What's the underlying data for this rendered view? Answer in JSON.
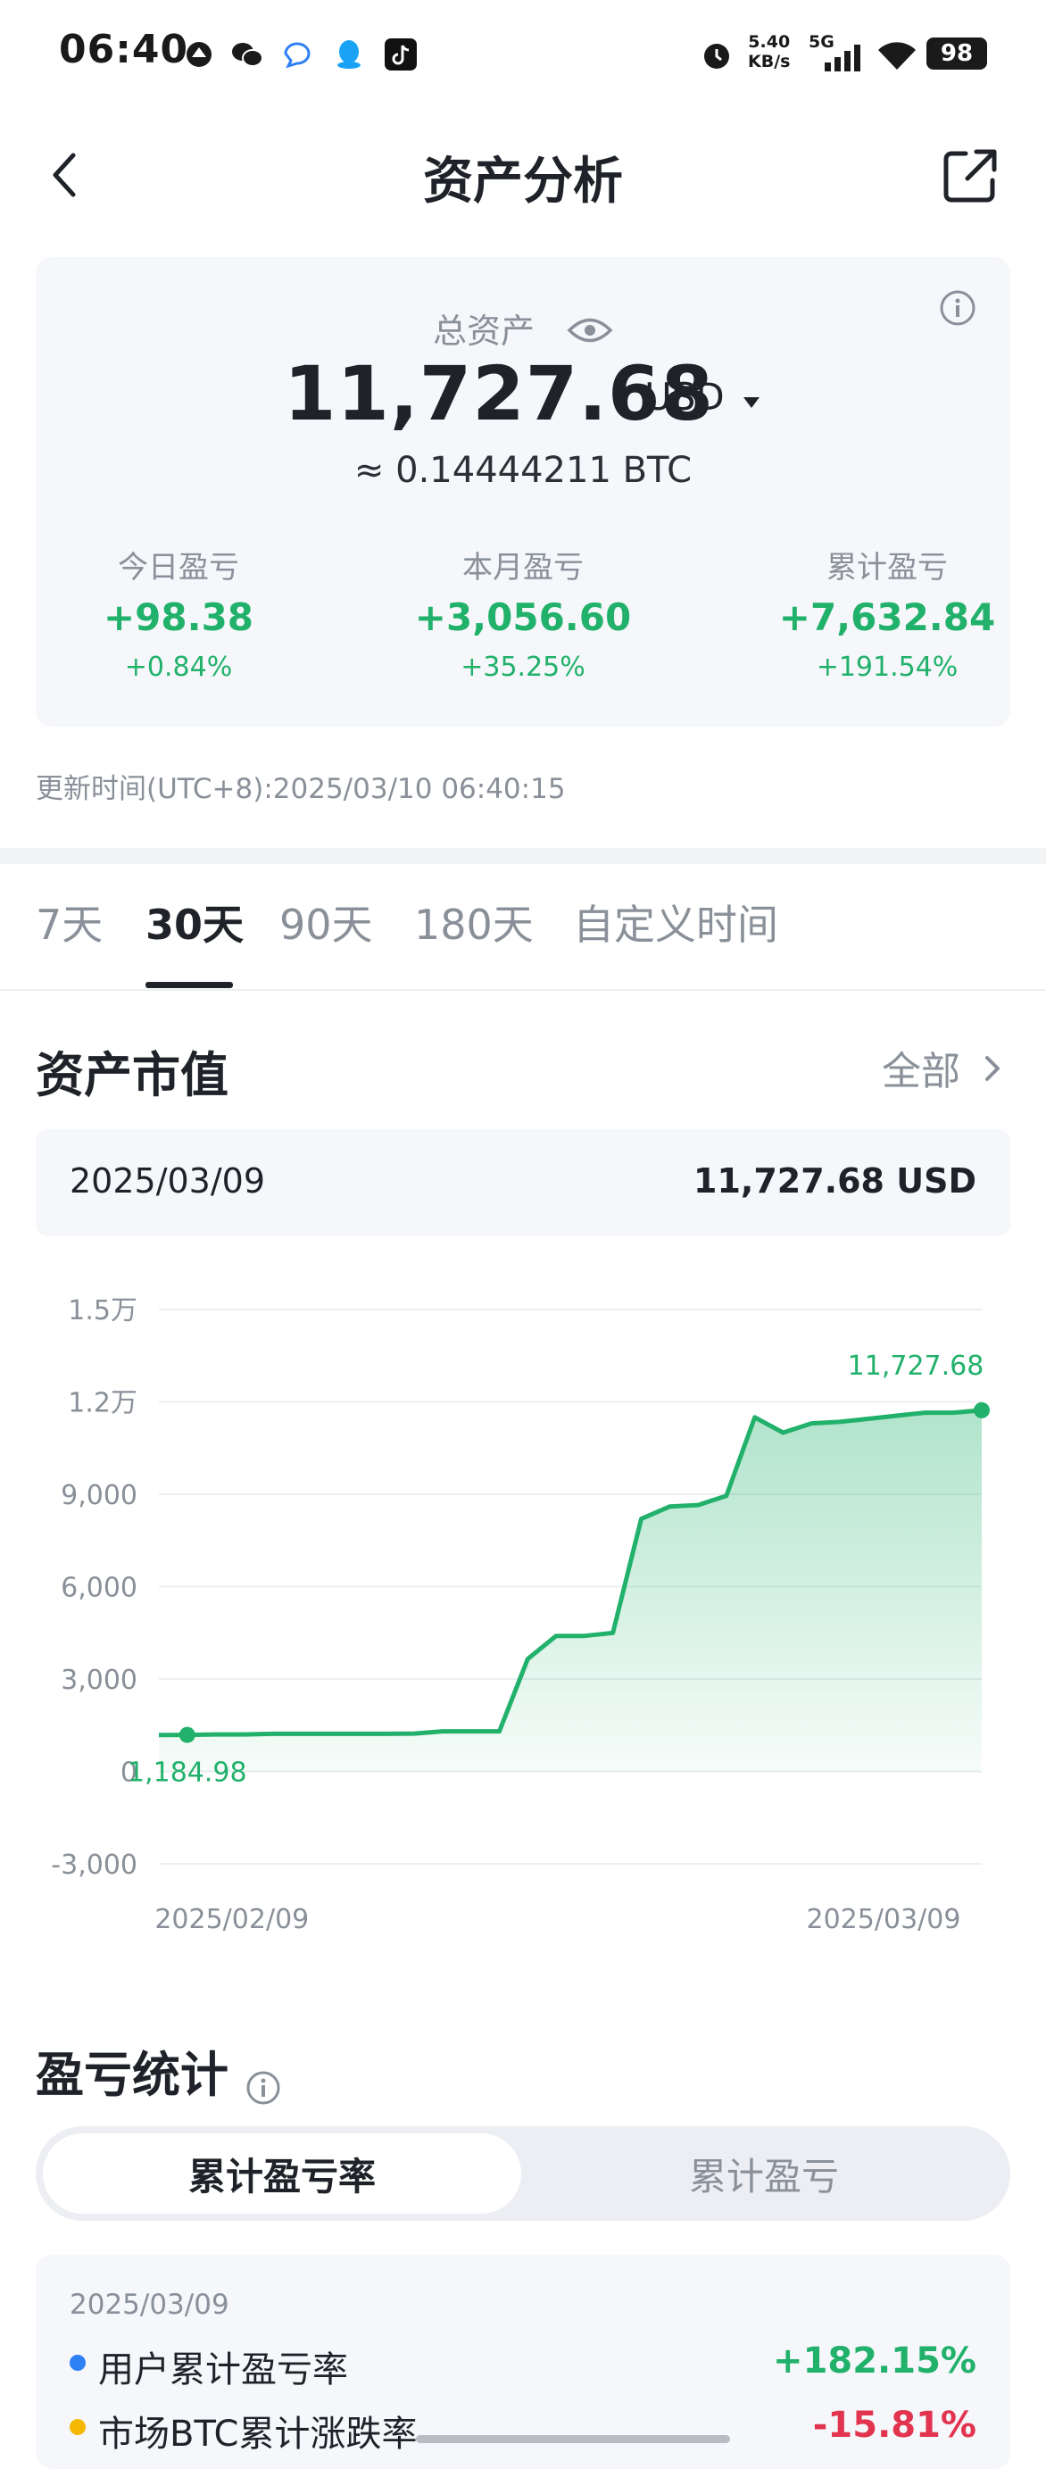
{
  "status_bar": {
    "time": "06:40",
    "net_speed_value": "5.40",
    "net_speed_unit": "KB/s",
    "network": "5G",
    "battery": "98"
  },
  "header": {
    "title": "资产分析"
  },
  "total": {
    "label": "总资产",
    "value": "11,727.68",
    "currency": "USD",
    "btc_equivalent": "≈ 0.14444211 BTC"
  },
  "stats": [
    {
      "label": "今日盈亏",
      "value": "+98.38",
      "pct": "+0.84%"
    },
    {
      "label": "本月盈亏",
      "value": "+3,056.60",
      "pct": "+35.25%"
    },
    {
      "label": "累计盈亏",
      "value": "+7,632.84",
      "pct": "+191.54%"
    }
  ],
  "update_time": "更新时间(UTC+8):2025/03/10 06:40:15",
  "tabs": [
    "7天",
    "30天",
    "90天",
    "180天",
    "自定义时间"
  ],
  "active_tab": "30天",
  "market_value": {
    "title": "资产市值",
    "all_link": "全部",
    "selected_date": "2025/03/09",
    "selected_value": "11,727.68 USD"
  },
  "chart_data": {
    "type": "area",
    "y_ticks": [
      "1.5万",
      "1.2万",
      "9,000",
      "6,000",
      "3,000",
      "0",
      "-3,000"
    ],
    "ylim": [
      -3000,
      15000
    ],
    "x_labels": [
      "2025/02/09",
      "2025/03/09"
    ],
    "x": [
      "2025/02/08",
      "2025/02/09",
      "2025/02/10",
      "2025/02/11",
      "2025/02/12",
      "2025/02/13",
      "2025/02/14",
      "2025/02/15",
      "2025/02/16",
      "2025/02/17",
      "2025/02/18",
      "2025/02/19",
      "2025/02/20",
      "2025/02/21",
      "2025/02/22",
      "2025/02/23",
      "2025/02/24",
      "2025/02/25",
      "2025/02/26",
      "2025/02/27",
      "2025/02/28",
      "2025/03/01",
      "2025/03/02",
      "2025/03/03",
      "2025/03/04",
      "2025/03/05",
      "2025/03/06",
      "2025/03/07",
      "2025/03/08",
      "2025/03/09"
    ],
    "values": [
      1180,
      1184.98,
      1200,
      1200,
      1220,
      1220,
      1220,
      1220,
      1220,
      1230,
      1300,
      1300,
      1300,
      3650,
      4400,
      4400,
      4500,
      8200,
      8600,
      8650,
      8950,
      11500,
      11000,
      11300,
      11350,
      11450,
      11550,
      11650,
      11650,
      11727.68
    ],
    "annotations": [
      {
        "label": "1,184.98",
        "x": "2025/02/09",
        "y": 1184.98
      },
      {
        "label": "11,727.68",
        "x": "2025/03/09",
        "y": 11727.68
      }
    ],
    "color": "#21b16b",
    "grid": true
  },
  "pnl": {
    "title": "盈亏统计",
    "segments": [
      "累计盈亏率",
      "累计盈亏"
    ],
    "active_segment": "累计盈亏率",
    "date": "2025/03/09",
    "rows": [
      {
        "name": "用户累计盈亏率",
        "value": "+182.15%",
        "dot_color": "#2f7ff5",
        "value_color": "#21b16b"
      },
      {
        "name": "市场BTC累计涨跌率",
        "value": "-15.81%",
        "dot_color": "#f5b800",
        "value_color": "#e2334f"
      }
    ]
  },
  "colors": {
    "up": "#21b16b",
    "down": "#e2334f",
    "text": "#1f2329",
    "muted": "#8a9099"
  }
}
